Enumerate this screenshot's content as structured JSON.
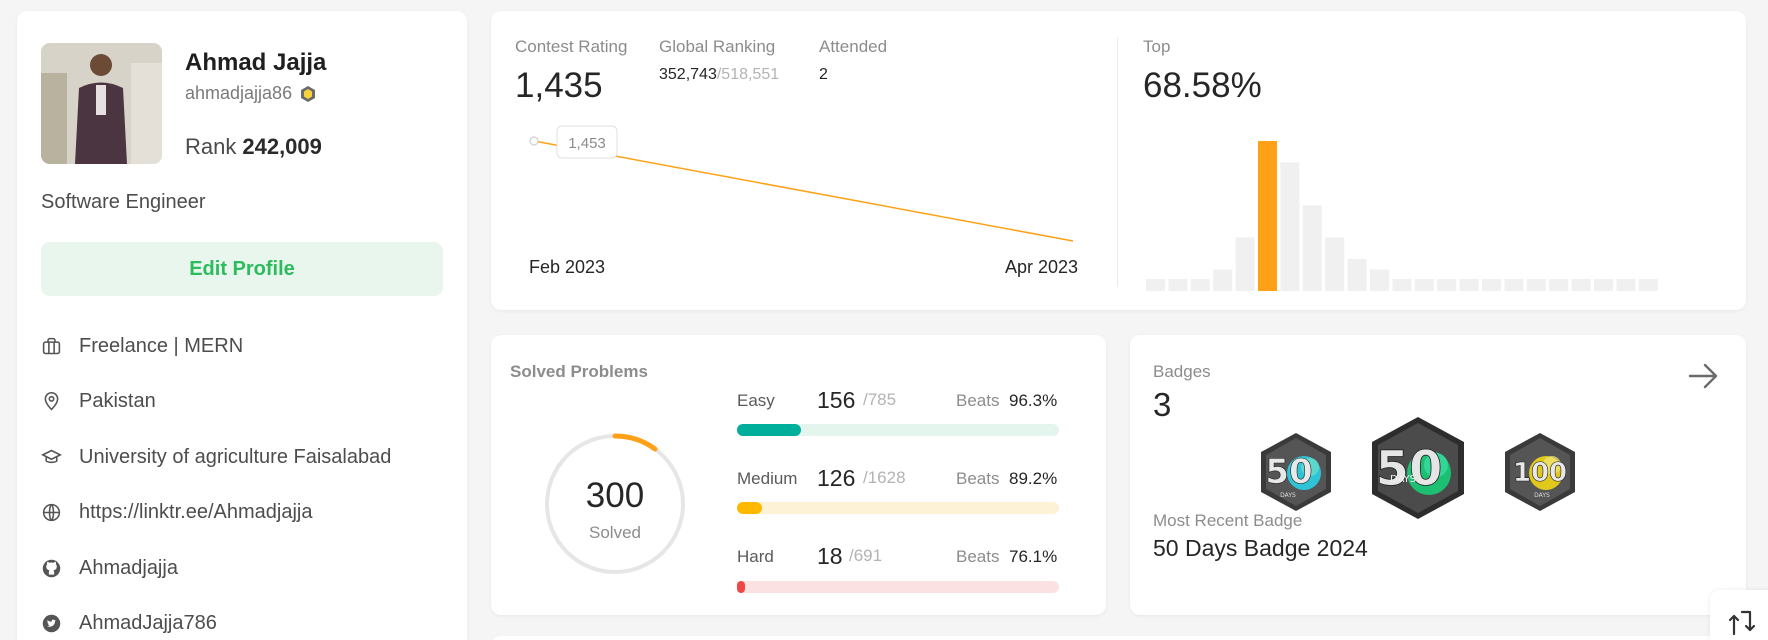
{
  "profile": {
    "name": "Ahmad Jajja",
    "username": "ahmadjajja86",
    "rank_label": "Rank",
    "rank_value": "242,009",
    "role": "Software Engineer",
    "edit_button": "Edit Profile",
    "info": [
      {
        "icon": "briefcase-icon",
        "text": "Freelance | MERN"
      },
      {
        "icon": "location-pin-icon",
        "text": "Pakistan"
      },
      {
        "icon": "graduation-cap-icon",
        "text": "University of agriculture Faisalabad"
      },
      {
        "icon": "globe-icon",
        "text": "https://linktr.ee/Ahmadjajja"
      },
      {
        "icon": "github-icon",
        "text": "Ahmadjajja"
      },
      {
        "icon": "twitter-icon",
        "text": "AhmadJajja786"
      }
    ]
  },
  "contest": {
    "rating_label": "Contest Rating",
    "rating_value": "1,435",
    "global_label": "Global Ranking",
    "global_value": "352,743",
    "global_total": "/518,551",
    "attended_label": "Attended",
    "attended_value": "2",
    "top_label": "Top",
    "top_value": "68.58%",
    "tooltip": "1,453",
    "x_start": "Feb 2023",
    "x_end": "Apr 2023",
    "line_points": [
      {
        "date": "Feb 2023",
        "rating": 1453
      },
      {
        "date": "Apr 2023",
        "rating": 1435
      }
    ],
    "histogram": [
      1,
      1,
      1,
      2,
      5,
      14,
      12,
      8,
      5,
      3,
      2,
      1,
      1,
      1,
      1,
      1,
      1,
      1,
      1,
      1,
      1,
      1,
      1
    ],
    "histogram_highlight_index": 5,
    "accent_color": "#ffa116"
  },
  "solved": {
    "title": "Solved Problems",
    "total": "300",
    "total_label": "Solved",
    "progress_fraction": 0.1,
    "rows": [
      {
        "label": "Easy",
        "count": "156",
        "total": "/785",
        "beats_label": "Beats",
        "beats": "96.3%",
        "fraction": 0.2,
        "color": "#00af9b",
        "track": "#e4f5ee"
      },
      {
        "label": "Medium",
        "count": "126",
        "total": "/1628",
        "beats_label": "Beats",
        "beats": "89.2%",
        "fraction": 0.077,
        "color": "#ffb800",
        "track": "#fdf1d6"
      },
      {
        "label": "Hard",
        "count": "18",
        "total": "/691",
        "beats_label": "Beats",
        "beats": "76.1%",
        "fraction": 0.026,
        "color": "#ef4743",
        "track": "#fbe1e1"
      }
    ]
  },
  "badges": {
    "label": "Badges",
    "count": "3",
    "recent_label": "Most Recent Badge",
    "recent_name": "50 Days Badge 2024",
    "items": [
      {
        "name": "50-days-badge",
        "number": "50",
        "sub": "DAYS",
        "color": "#2ec4d6"
      },
      {
        "name": "50-days-badge-2024",
        "number": "50",
        "sub": "DAYS",
        "color": "#1dbf73"
      },
      {
        "name": "100-days-badge",
        "number": "100",
        "sub": "DAYS",
        "color": "#e0c81c"
      }
    ]
  }
}
